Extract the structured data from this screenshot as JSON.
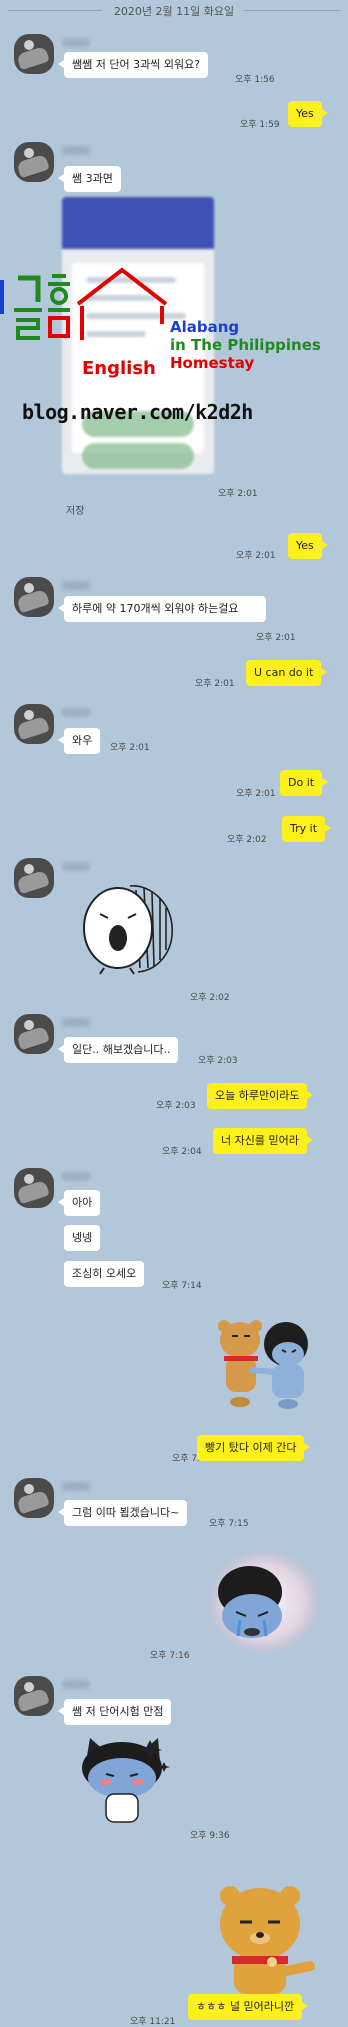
{
  "header": {
    "date": "2020년 2월 11일 화요일"
  },
  "messages": {
    "m1": {
      "text": "쌤쌤 저 단어 3과씩 외워요?",
      "time": "오후 1:56"
    },
    "m2": {
      "text": "Yes",
      "time": "오후 1:59"
    },
    "m3": {
      "text": "쌤 3과면",
      "time": "오후 2:01",
      "save_label": "저장"
    },
    "m4": {
      "text": "Yes",
      "time": "오후 2:01"
    },
    "m5": {
      "text": "하루에 약 170개씩 외워야 하는걸요",
      "time": "오후 2:01"
    },
    "m6": {
      "text": "U can do it",
      "time": "오후 2:01"
    },
    "m7": {
      "text": "와우",
      "time": "오후 2:01"
    },
    "m8": {
      "text": "Do it",
      "time": "오후 2:01"
    },
    "m9": {
      "text": "Try it",
      "time": "오후 2:02"
    },
    "m10": {
      "time": "오후 2:02"
    },
    "m11": {
      "text": "일단.. 해보겠습니다..",
      "time": "오후 2:03"
    },
    "m12": {
      "text": "오늘 하루만이라도",
      "time": "오후 2:03"
    },
    "m13": {
      "text": "너 자신를 믿어라",
      "time": "오후 2:04"
    },
    "m14": {
      "text": "아아"
    },
    "m15": {
      "text": "넹넹"
    },
    "m16": {
      "text": "조심히 오세오",
      "time": "오후 7:14"
    },
    "m17": {
      "text": "빵기 탔다 이제 간다",
      "time": "오후 7:14"
    },
    "m18": {
      "text": "그럼 이따 뵙겠습니다~",
      "time": "오후 7:15"
    },
    "m19": {
      "time": "오후 7:16"
    },
    "m20": {
      "text": "쌤 저 단어시험 만점"
    },
    "m21": {
      "time": "오후 9:36"
    },
    "m22": {
      "text": "ㅎㅎㅎ 널 믿어라니깐",
      "time": "오후 11:21"
    }
  },
  "watermark": {
    "brand": "글홈",
    "english": "English",
    "line1": "Alabang",
    "line2": "in The Philippines",
    "line3": "Homestay",
    "blog": "blog.naver.com/k2d2h"
  },
  "icons": {
    "avatar": "profile-photo",
    "sticker_mouth": "screaming-face-sticker",
    "sticker_friends": "ryan-hugging-friend-sticker",
    "sticker_crying": "crying-character-sticker",
    "sticker_shy": "blushing-cat-sticker",
    "sticker_ryan": "ryan-smirking-sticker"
  },
  "colors": {
    "background": "#b2c7d9",
    "incoming_bubble": "#ffffff",
    "outgoing_bubble": "#fef01b"
  }
}
